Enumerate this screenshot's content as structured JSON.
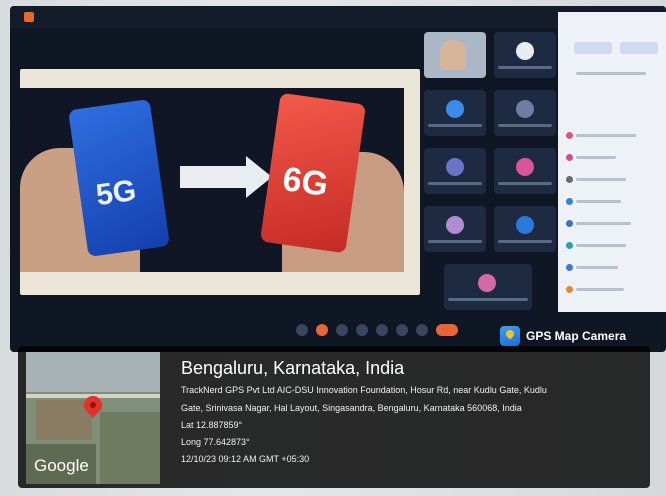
{
  "gps_overlay": {
    "app_label": "GPS Map Camera",
    "place_title": "Bengaluru, Karnataka, India",
    "address_line1": "TrackNerd GPS Pvt Ltd AIC-DSU Innovation Foundation, Hosur Rd, near Kudlu Gate, Kudlu",
    "address_line2": "Gate, Srinivasa Nagar, Hal Layout, Singasandra, Bengaluru, Karnataka 560068, India",
    "latitude": "Lat 12.887859°",
    "longitude": "Long 77.642873°",
    "timestamp": "12/10/23 09:12 AM GMT +05:30",
    "map_provider": "Google"
  },
  "slide": {
    "left_phone_label": "5G",
    "right_phone_label": "6G"
  },
  "colors": {
    "slide_bg": "#101626",
    "phone_5g": "#2e6fe0",
    "phone_6g": "#e8463a",
    "map_pin": "#e1332b",
    "overlay_bg": "#000000"
  }
}
